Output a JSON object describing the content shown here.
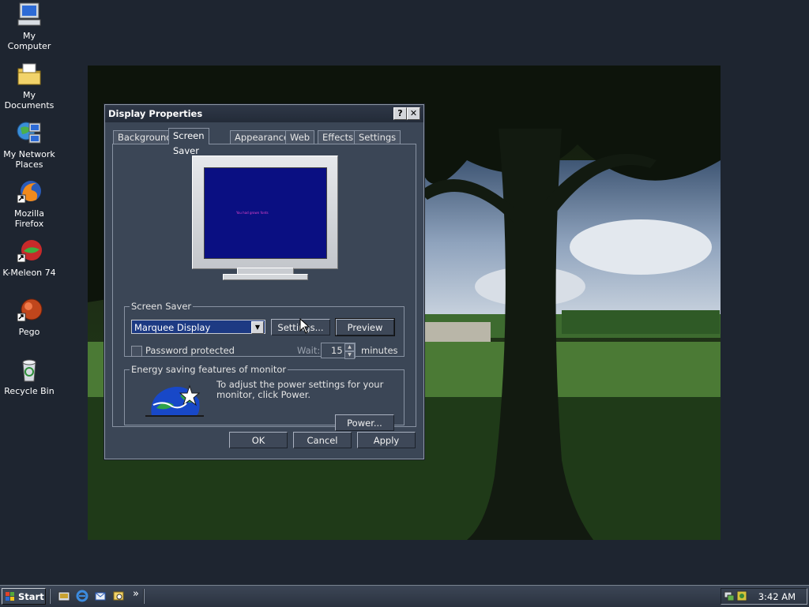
{
  "desktop": {
    "icons": [
      {
        "label": "My Computer"
      },
      {
        "label": "My Documents"
      },
      {
        "label": "My Network Places"
      },
      {
        "label": "Mozilla Firefox"
      },
      {
        "label": "K-Meleon 74"
      },
      {
        "label": "Pego"
      },
      {
        "label": "Recycle Bin"
      }
    ]
  },
  "dialog": {
    "title": "Display Properties",
    "help_button": "?",
    "close_button": "✕",
    "tabs": [
      {
        "label": "Background",
        "active": false
      },
      {
        "label": "Screen Saver",
        "active": true
      },
      {
        "label": "Appearance",
        "active": false
      },
      {
        "label": "Web",
        "active": false
      },
      {
        "label": "Effects",
        "active": false
      },
      {
        "label": "Settings",
        "active": false
      }
    ],
    "preview_text": "You had grown fonts",
    "screen_saver": {
      "group_label": "Screen Saver",
      "selected": "Marquee Display",
      "settings_button": "Settings...",
      "preview_button": "Preview",
      "password_label": "Password protected",
      "password_checked": false,
      "wait_label": "Wait:",
      "wait_value": "15",
      "minutes_label": "minutes"
    },
    "energy": {
      "group_label": "Energy saving features of monitor",
      "description": "To adjust the power settings for your monitor, click Power.",
      "power_button": "Power..."
    },
    "buttons": {
      "ok": "OK",
      "cancel": "Cancel",
      "apply": "Apply"
    }
  },
  "taskbar": {
    "start_label": "Start",
    "more_label": "»",
    "clock": "3:42 AM"
  },
  "colors": {
    "desktop_bg": "#1e2530",
    "dialog_bg": "#3b4656",
    "preview_screen": "#0a0f82",
    "selection": "#1d3a83"
  }
}
